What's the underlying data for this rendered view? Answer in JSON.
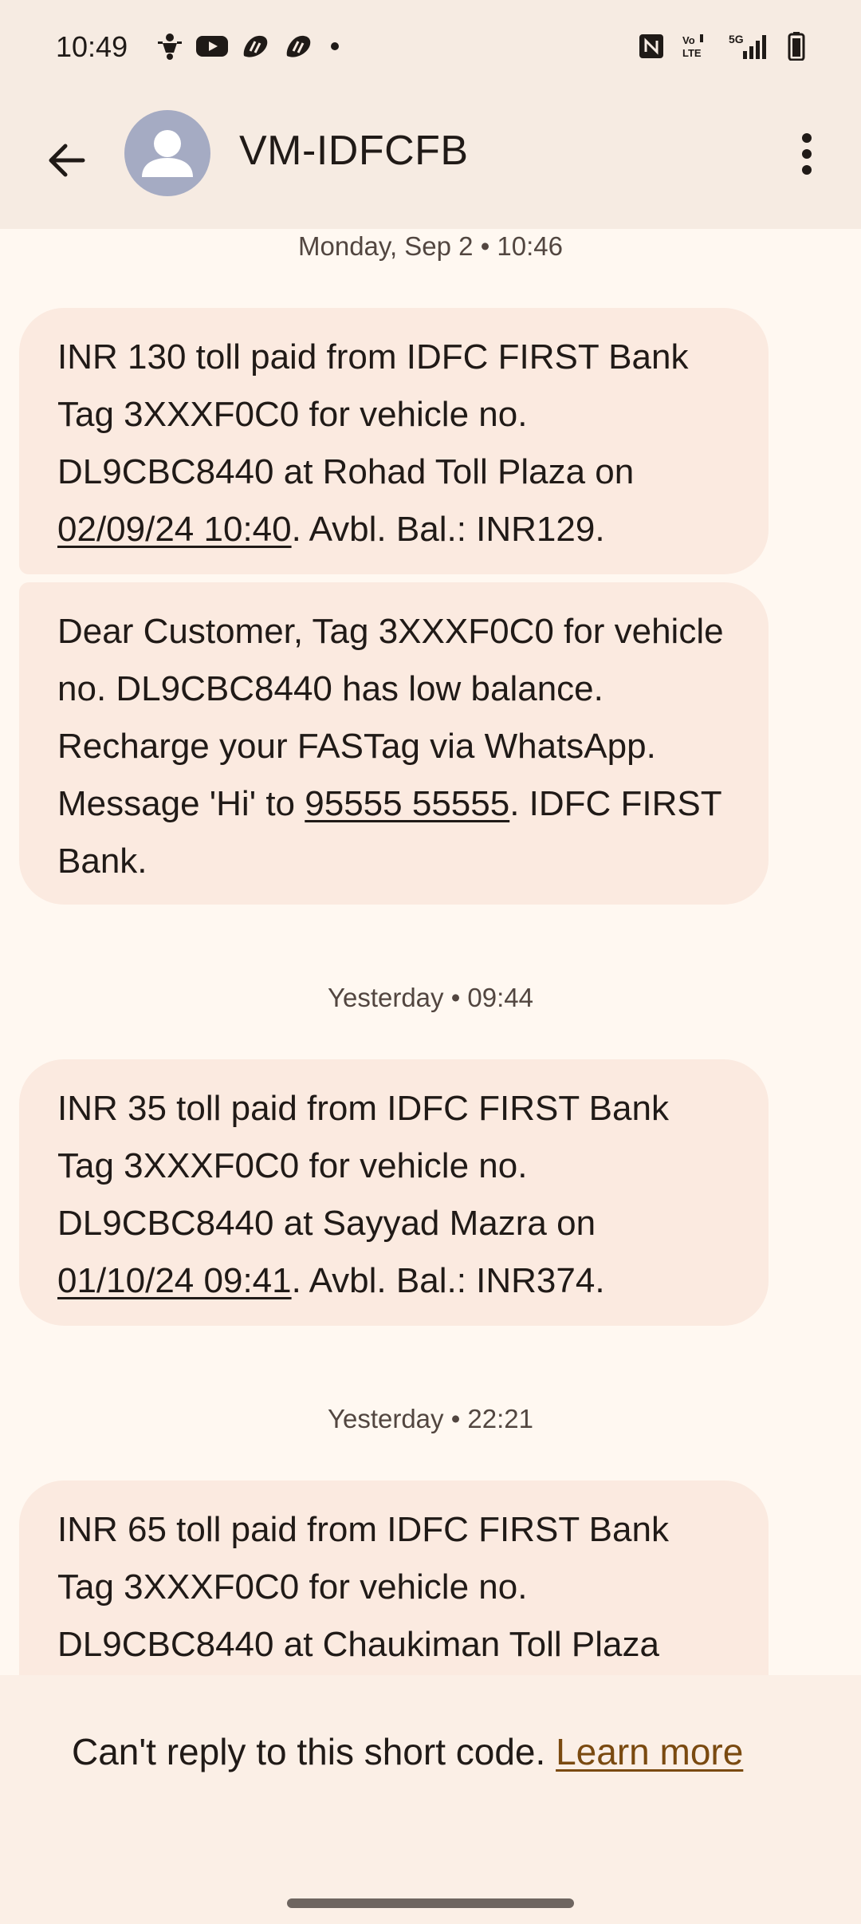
{
  "status_bar": {
    "time": "10:49",
    "left_icons": [
      "scooter-icon",
      "youtube-icon",
      "swiggy-icon",
      "swiggy-icon",
      "dot-icon"
    ],
    "right_icons": [
      "nfc-icon",
      "volte-icon",
      "signal-5g-icon",
      "battery-icon"
    ],
    "network_label": "5G",
    "volte_label": "Vo LTE"
  },
  "app_bar": {
    "title": "VM-IDFCFB"
  },
  "conversation": {
    "groups": [
      {
        "timestamp": "Monday, Sep 2 • 10:46",
        "messages": [
          {
            "parts": [
              "INR 130 toll paid from IDFC FIRST Bank Tag 3XXXF0C0 for vehicle no. DL9CBC8440 at Rohad Toll Plaza on ",
              "02/09/24 10:40",
              ". Avbl. Bal.: INR129."
            ]
          },
          {
            "parts": [
              "Dear Customer, Tag 3XXXF0C0 for vehicle no. DL9CBC8440 has low balance. Recharge your FASTag via WhatsApp. Message 'Hi' to ",
              "95555 55555",
              ". IDFC FIRST Bank."
            ]
          }
        ]
      },
      {
        "timestamp": "Yesterday • 09:44",
        "messages": [
          {
            "parts": [
              "INR 35 toll paid from IDFC FIRST Bank Tag 3XXXF0C0 for vehicle no. DL9CBC8440 at Sayyad Mazra on ",
              "01/10/24 09:41",
              ". Avbl. Bal.: INR374."
            ]
          }
        ]
      },
      {
        "timestamp": "Yesterday • 22:21",
        "messages": [
          {
            "parts": [
              "INR 65 toll paid from IDFC FIRST Bank Tag 3XXXF0C0 for vehicle no. DL9CBC8440 at Chaukiman Toll Plaza"
            ]
          }
        ]
      }
    ]
  },
  "footer": {
    "text": "Can't reply to this short code. ",
    "link": "Learn more"
  }
}
